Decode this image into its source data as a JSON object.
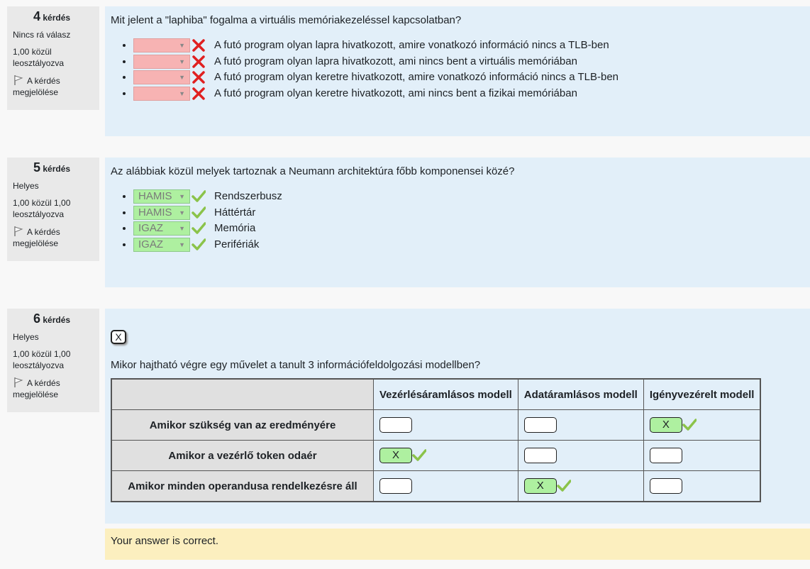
{
  "questions": [
    {
      "number": "4",
      "label": "kérdés",
      "state": "Nincs rá válasz",
      "grade": "1,00 közül leosztályozva",
      "flag": "A kérdés megjelölése",
      "text": "Mit jelent a \"laphiba\" fogalma a virtuális memóriakezeléssel kapcsolatban?",
      "items": [
        {
          "value": "",
          "result": "incorrect",
          "text": "A futó program olyan lapra hivatkozott, amire vonatkozó információ nincs a TLB-ben"
        },
        {
          "value": "",
          "result": "incorrect",
          "text": "A futó program olyan lapra hivatkozott, ami nincs bent a virtuális memóriában"
        },
        {
          "value": "",
          "result": "incorrect",
          "text": "A futó program olyan keretre hivatkozott, amire vonatkozó információ nincs a TLB-ben"
        },
        {
          "value": "",
          "result": "incorrect",
          "text": "A futó program olyan keretre hivatkozott, ami nincs bent a fizikai memóriában"
        }
      ]
    },
    {
      "number": "5",
      "label": "kérdés",
      "state": "Helyes",
      "grade": "1,00 közül 1,00 leosztályozva",
      "flag": "A kérdés megjelölése",
      "text": "Az alábbiak közül melyek tartoznak a Neumann architektúra főbb komponensei közé?",
      "items": [
        {
          "value": "HAMIS",
          "result": "correct",
          "text": "Rendszerbusz"
        },
        {
          "value": "HAMIS",
          "result": "correct",
          "text": "Háttértár"
        },
        {
          "value": "IGAZ",
          "result": "correct",
          "text": "Memória"
        },
        {
          "value": "IGAZ",
          "result": "correct",
          "text": "Perifériák"
        }
      ]
    },
    {
      "number": "6",
      "label": "kérdés",
      "state": "Helyes",
      "grade": "1,00 közül 1,00 leosztályozva",
      "flag": "A kérdés megjelölése",
      "button": "X",
      "text": "Mikor hajtható végre egy művelet a tanult 3 információfeldolgozási modellben?",
      "columns": [
        "Vezérlésáramlásos modell",
        "Adatáramlásos modell",
        "Igényvezérelt modell"
      ],
      "rows": [
        {
          "label": "Amikor szükség van az eredményére",
          "cells": [
            "",
            "",
            "X"
          ]
        },
        {
          "label": "Amikor a vezérlő token odaér",
          "cells": [
            "X",
            "",
            ""
          ]
        },
        {
          "label": "Amikor minden operandusa rendelkezésre áll",
          "cells": [
            "",
            "X",
            ""
          ]
        }
      ],
      "feedback": "Your answer is correct."
    }
  ],
  "icons": {
    "flag": "flag-icon",
    "incorrect": "cross-icon",
    "correct": "check-icon",
    "dropdown": "dropdown-arrow-icon"
  },
  "colors": {
    "incorrect_bg": "#f7b3b3",
    "correct_bg": "#aef0a0",
    "cross": "#e02020",
    "check": "#8bc34a",
    "content_bg": "#e2eff9",
    "feedback_bg": "#fcefbf"
  }
}
